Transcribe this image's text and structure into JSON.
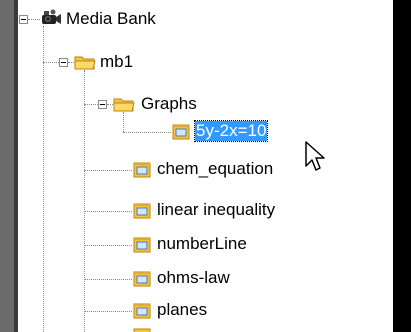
{
  "tree": {
    "root": {
      "label": "Media Bank",
      "icon": "camera-icon",
      "expanded": true
    },
    "child": {
      "label": "mb1",
      "icon": "folder-icon",
      "expanded": true
    },
    "graphs_folder": {
      "label": "Graphs",
      "icon": "folder-icon",
      "expanded": true
    },
    "graph_item": {
      "label": "5y-2x=10",
      "icon": "document-icon",
      "selected": true
    },
    "items": [
      {
        "label": "chem_equation",
        "icon": "document-icon"
      },
      {
        "label": "linear inequality",
        "icon": "document-icon"
      },
      {
        "label": "numberLine",
        "icon": "document-icon"
      },
      {
        "label": "ohms-law",
        "icon": "document-icon"
      },
      {
        "label": "planes",
        "icon": "document-icon"
      }
    ]
  },
  "colors": {
    "selection": "#3399ff",
    "folder": "#f6c343",
    "background": "#ffffff"
  }
}
